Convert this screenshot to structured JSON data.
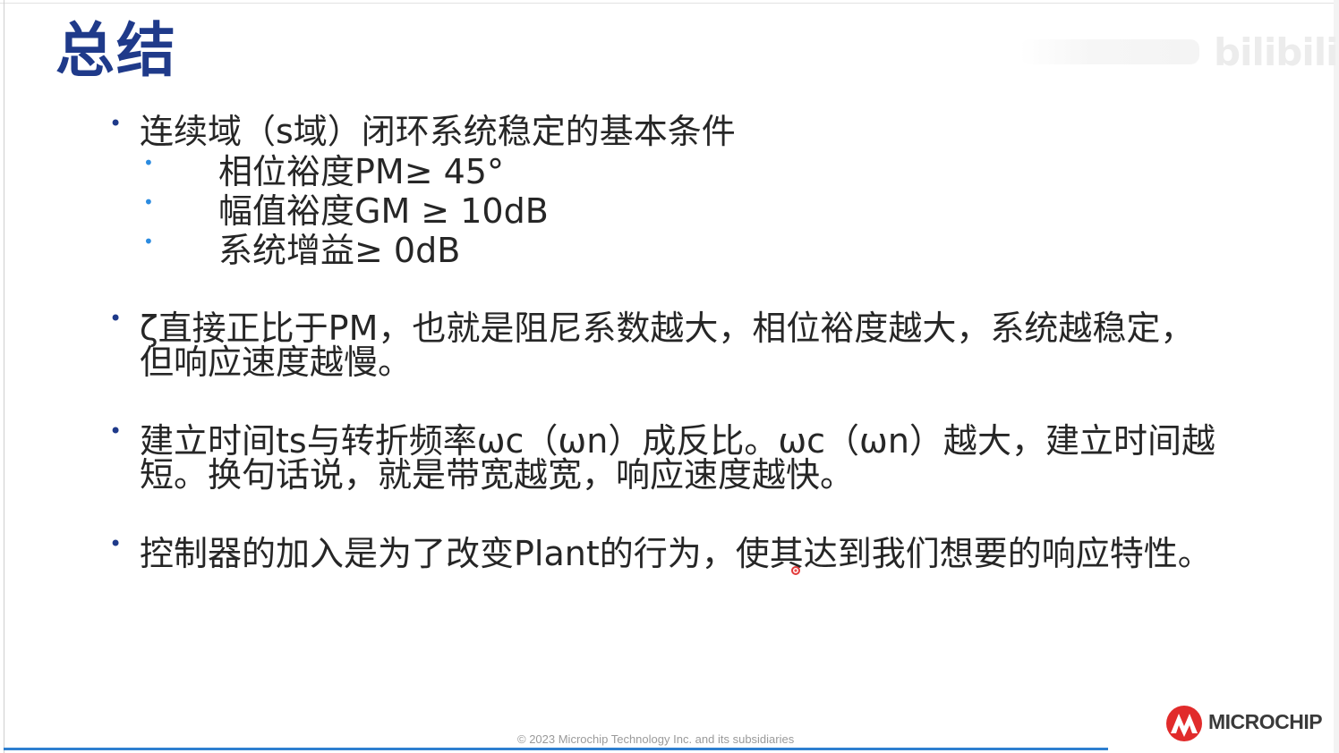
{
  "slide": {
    "title": "总结",
    "watermark": "bilibili",
    "bullets": [
      {
        "text": "连续域（s域）闭环系统稳定的基本条件",
        "sub": [
          "相位裕度PM≥ 45°",
          "幅值裕度GM ≥ 10dB",
          "系统增益≥ 0dB"
        ]
      },
      {
        "line1": "ζ直接正比于PM，也就是阻尼系数越大，相位裕度越大，系统越稳定，",
        "line2": "但响应速度越慢。"
      },
      {
        "line1": "建立时间ts与转折频率ωc（ωn）成反比。ωc（ωn）越大，建立时间越",
        "line2": "短。换句话说，就是带宽越宽，响应速度越快。"
      },
      {
        "line1": "控制器的加入是为了改变Plant的行为，使其达到我们想要的响应特性。"
      }
    ],
    "footer": "© 2023 Microchip Technology Inc. and its subsidiaries",
    "logo_text": "MICROCHIP",
    "colors": {
      "title": "#1f3a8a",
      "sub_bullet": "#2b8be0",
      "progress": "#2e7fd0",
      "logo_red": "#e12b2b"
    }
  }
}
